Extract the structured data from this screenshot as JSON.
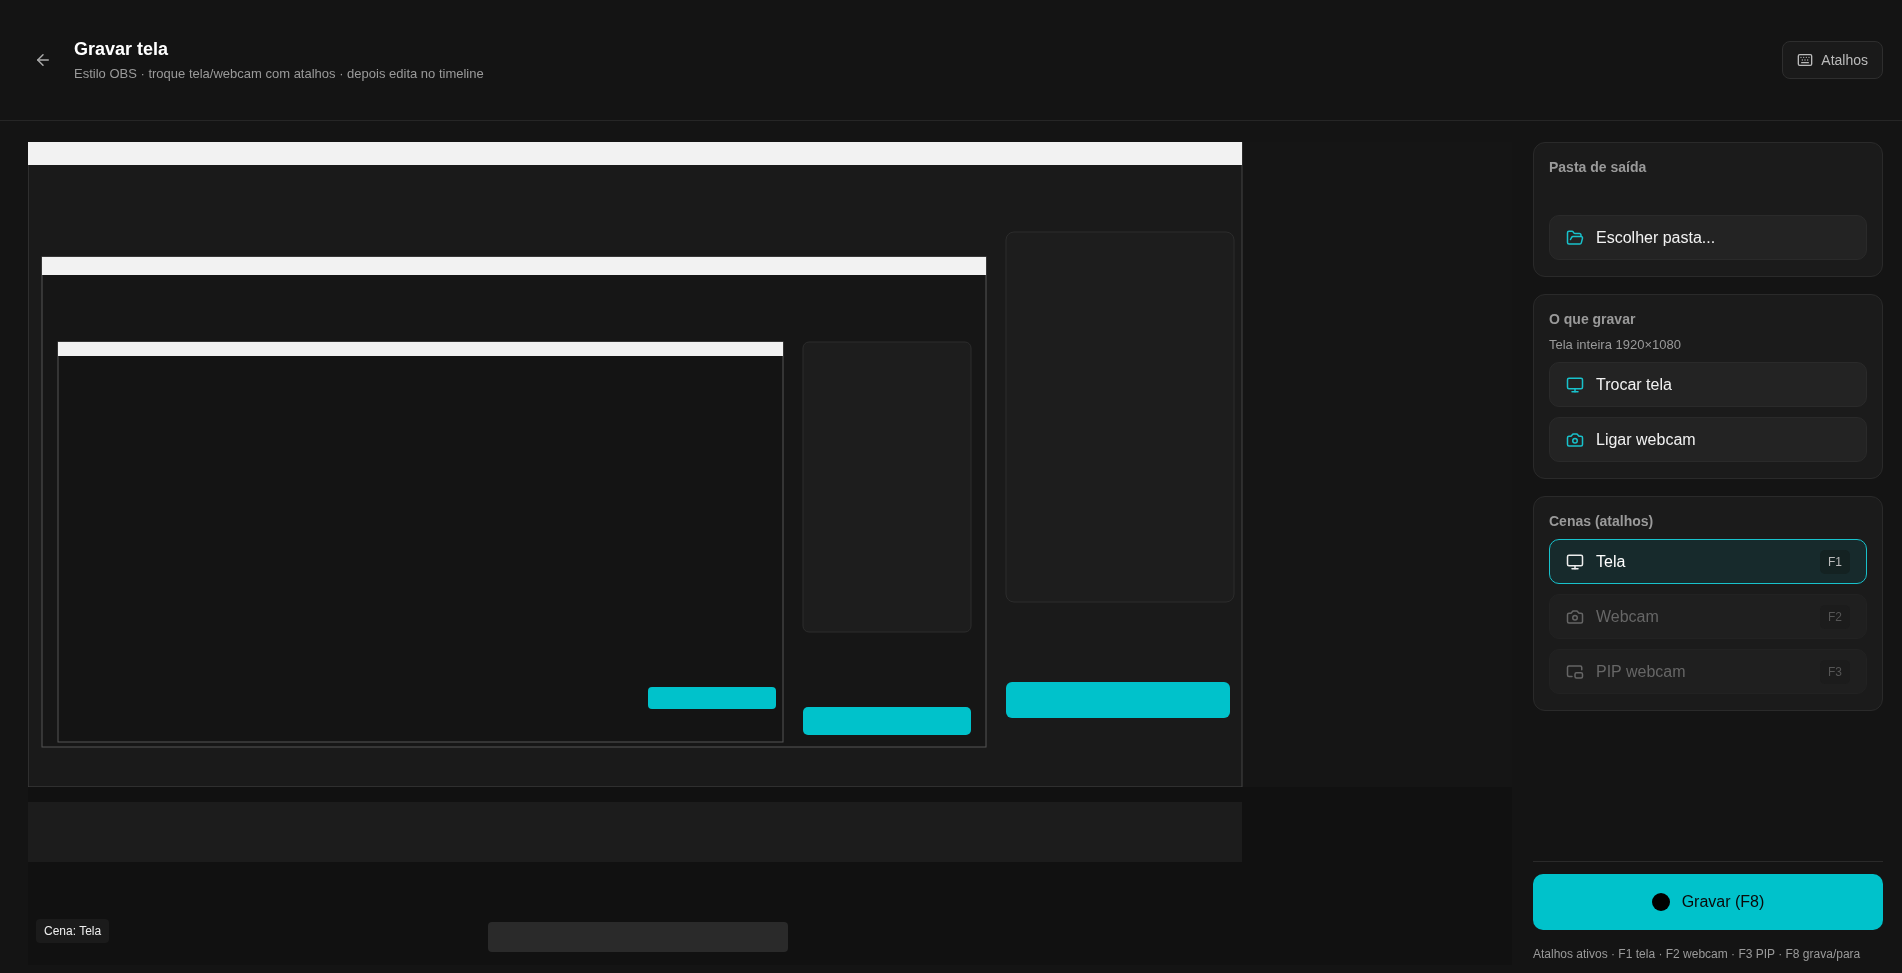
{
  "header": {
    "title": "Gravar tela",
    "subtitle": "Estilo OBS · troque tela/webcam com atalhos · depois edita no timeline",
    "shortcuts_button": "Atalhos"
  },
  "preview": {
    "kind": "picture",
    "scene_badge": "Cena: Tela"
  },
  "output_folder": {
    "title": "Pasta de saída",
    "button": "Escolher pasta..."
  },
  "what_to_record": {
    "title": "O que gravar",
    "info": "Tela inteira 1920×1080",
    "buttons": [
      {
        "label": "Trocar tela",
        "kind": "screen"
      },
      {
        "label": "Ligar webcam",
        "kind": "camera"
      }
    ]
  },
  "scenes": {
    "title": "Cenas (atalhos)",
    "items": [
      {
        "label": "Tela",
        "key": "F1",
        "kind": "screen",
        "selected": true
      },
      {
        "label": "Webcam",
        "key": "F2",
        "kind": "camera",
        "selected": false
      },
      {
        "label": "PIP webcam",
        "key": "F3",
        "kind": "pip",
        "selected": false
      }
    ]
  },
  "record_button": "Gravar (F8)",
  "footer": "Atalhos ativos · F1 tela · F2 webcam · F3 PIP · F8 grava/para"
}
